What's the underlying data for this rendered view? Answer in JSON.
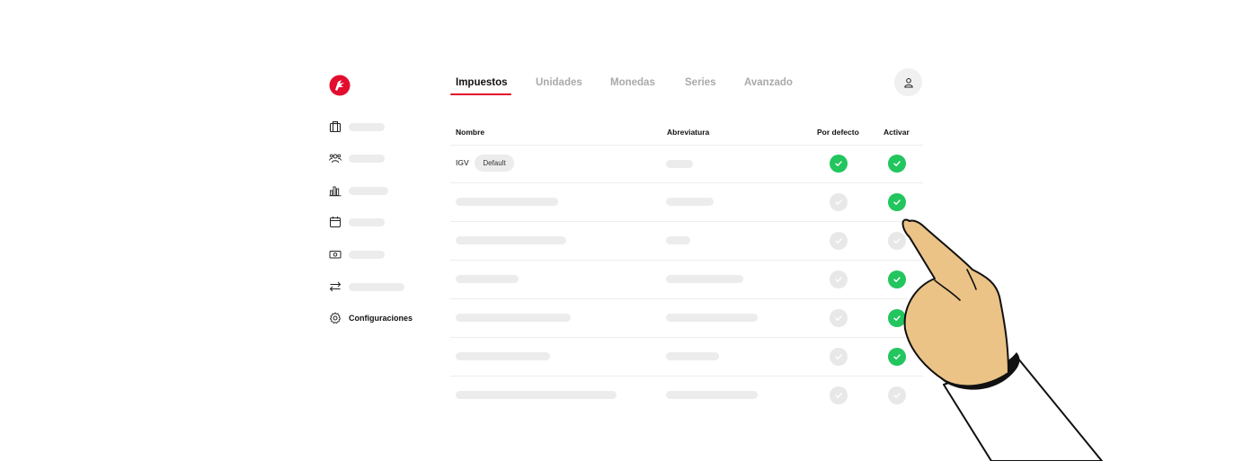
{
  "colors": {
    "brand": "#e30d2e",
    "check_on": "#22c55e",
    "check_off": "#e8e8e8",
    "placeholder": "#ececec",
    "skin": "#ebc386"
  },
  "sidebar": {
    "items": [
      {
        "icon": "briefcase-icon",
        "label": ""
      },
      {
        "icon": "users-icon",
        "label": ""
      },
      {
        "icon": "bar-chart-icon",
        "label": ""
      },
      {
        "icon": "calendar-icon",
        "label": ""
      },
      {
        "icon": "banknote-icon",
        "label": ""
      },
      {
        "icon": "transfer-arrows-icon",
        "label": ""
      },
      {
        "icon": "gear-icon",
        "label": "Configuraciones"
      }
    ]
  },
  "tabs": [
    {
      "label": "Impuestos",
      "active": true
    },
    {
      "label": "Unidades",
      "active": false
    },
    {
      "label": "Monedas",
      "active": false
    },
    {
      "label": "Series",
      "active": false
    },
    {
      "label": "Avanzado",
      "active": false
    }
  ],
  "table": {
    "headers": {
      "name": "Nombre",
      "abbr": "Abreviatura",
      "default": "Por defecto",
      "active": "Activar"
    },
    "rows": [
      {
        "name": "IGV",
        "badge": "Default",
        "default": true,
        "active": true
      },
      {
        "name": "",
        "default": false,
        "active": true
      },
      {
        "name": "",
        "default": false,
        "active": false
      },
      {
        "name": "",
        "default": false,
        "active": true
      },
      {
        "name": "",
        "default": false,
        "active": true
      },
      {
        "name": "",
        "default": false,
        "active": true
      },
      {
        "name": "",
        "default": false,
        "active": false
      }
    ]
  }
}
